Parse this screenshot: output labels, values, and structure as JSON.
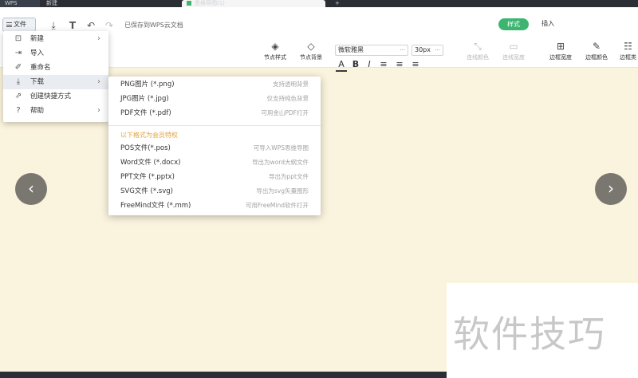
{
  "tabs": {
    "app": "WPS",
    "new_tab": "新建",
    "doc_tab": "思维导图(1)",
    "plus": "+"
  },
  "toolbar": {
    "file_label": "文件",
    "saved_status": "已保存到WPS云文档",
    "style_tab": "样式",
    "insert_tab": "插入",
    "node_style": "节点样式",
    "node_background": "节点背景",
    "line_color": "连线颜色",
    "line_width": "连线宽度",
    "border_width": "边框宽度",
    "border_color": "边框颜色",
    "border_type": "边框类",
    "font_name": "微软雅黑",
    "font_size": "30px",
    "dropdown_glyph": "···",
    "format_a": "A",
    "format_bold": "B",
    "format_italic": "I"
  },
  "file_menu": [
    {
      "icon": "new-file-icon",
      "label": "新建",
      "has_submenu": true
    },
    {
      "icon": "import-icon",
      "label": "导入",
      "has_submenu": false
    },
    {
      "icon": "rename-icon",
      "label": "重命名",
      "has_submenu": false
    },
    {
      "icon": "download-icon",
      "label": "下载",
      "has_submenu": true
    },
    {
      "icon": "shortcut-icon",
      "label": "创建快捷方式",
      "has_submenu": false
    },
    {
      "icon": "help-icon",
      "label": "帮助",
      "has_submenu": true
    }
  ],
  "download_submenu": {
    "items": [
      {
        "label": "PNG图片 (*.png)",
        "hint": "支持透明背景"
      },
      {
        "label": "JPG图片 (*.jpg)",
        "hint": "仅支持纯色背景"
      },
      {
        "label": "PDF文件 (*.pdf)",
        "hint": "可用金山PDF打开"
      }
    ],
    "section_label": "以下格式为会员特权",
    "member_items": [
      {
        "label": "POS文件(*.pos)",
        "hint": "可导入WPS思维导图"
      },
      {
        "label": "Word文件 (*.docx)",
        "hint": "导出为word大纲文件"
      },
      {
        "label": "PPT文件 (*.pptx)",
        "hint": "导出为ppt文件"
      },
      {
        "label": "SVG文件 (*.svg)",
        "hint": "导出为svg矢量图形"
      },
      {
        "label": "FreeMind文件 (*.mm)",
        "hint": "可用FreeMind软件打开"
      }
    ]
  },
  "navigation": {
    "prev": "‹",
    "next": "›"
  },
  "watermark": "软件技巧",
  "colors": {
    "accent_green": "#3eb471",
    "canvas_bg": "#faf3dd",
    "member_orange": "#e3a33a"
  }
}
